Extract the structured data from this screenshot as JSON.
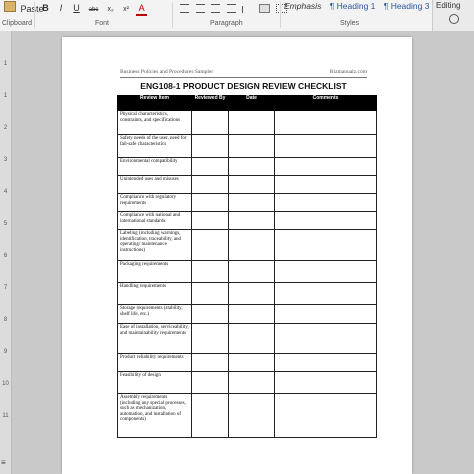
{
  "ribbon": {
    "paste_label": "Paste",
    "clipboard_label": "Clipboard",
    "font_label": "Font",
    "paragraph_label": "Paragraph",
    "styles_label": "Styles",
    "editing_label": "Editing",
    "style_items": [
      "Emphasis",
      "¶ Heading 1",
      "¶ Heading 3"
    ],
    "format_buttons": [
      "B",
      "I",
      "U",
      "abc",
      "x₂",
      "x²",
      "A"
    ]
  },
  "document": {
    "header_left": "Business Policies and Procedures Sampler",
    "header_right": "Bizmanualz.com",
    "title": "ENG108-1 PRODUCT DESIGN REVIEW CHECKLIST",
    "columns": [
      "Review Item",
      "Reviewed By",
      "Date",
      "Comments"
    ],
    "rows": [
      {
        "item": "Physical characteristics, constraints, and specifications",
        "h": 24
      },
      {
        "item": "Safety needs of the user, need for fail-safe characteristics",
        "h": 23
      },
      {
        "item": "Environmental compatibility",
        "h": 18
      },
      {
        "item": "Unintended uses and misuses",
        "h": 18
      },
      {
        "item": "Compliance with regulatory requirements",
        "h": 18
      },
      {
        "item": "Compliance with national and international standards",
        "h": 18
      },
      {
        "item": "Labeling (including warnings, identification, traceability, and operating/ maintenance instructions)",
        "h": 31
      },
      {
        "item": "Packaging requirements",
        "h": 22
      },
      {
        "item": "Handling requirements",
        "h": 22
      },
      {
        "item": "Storage requirements (stability, shelf life, etc.)",
        "h": 19
      },
      {
        "item": "Ease of installation, serviceability, and maintainability requirements",
        "h": 30
      },
      {
        "item": "Product reliability requirements",
        "h": 18
      },
      {
        "item": "Feasibility of design",
        "h": 22
      },
      {
        "item": "Assembly requirements (including any special processes, such as mechanization, automation, and installation of components)",
        "h": 44
      }
    ]
  }
}
